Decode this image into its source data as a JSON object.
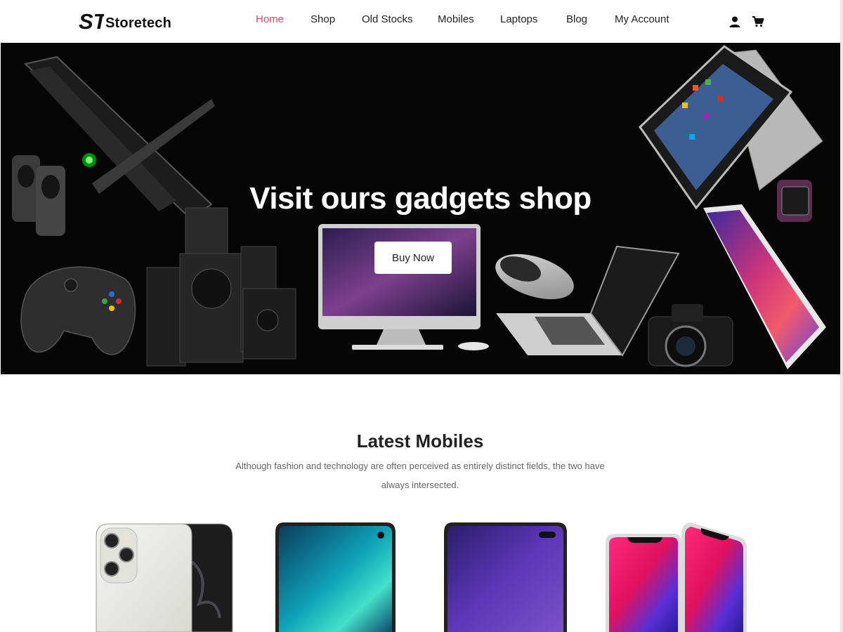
{
  "header": {
    "logo_mark": "ST",
    "logo_text": "Storetech",
    "nav": [
      {
        "label": "Home",
        "active": true
      },
      {
        "label": "Shop",
        "active": false
      },
      {
        "label": "Old Stocks",
        "active": false
      },
      {
        "label": "Mobiles",
        "active": false
      },
      {
        "label": "Laptops",
        "active": false
      },
      {
        "label": "Blog",
        "active": false
      },
      {
        "label": "My Account",
        "active": false
      }
    ],
    "icons": [
      "user-icon",
      "cart-icon"
    ]
  },
  "hero": {
    "title": "Visit ours gadgets shop",
    "button_label": "Buy Now"
  },
  "latest": {
    "title": "Latest Mobiles",
    "description": "Although fashion and technology are often perceived as entirely distinct fields, the two have always intersected."
  },
  "colors": {
    "accent": "#ef4368",
    "hero_background": "#060606",
    "text": "#222222",
    "muted_text": "#666666"
  }
}
